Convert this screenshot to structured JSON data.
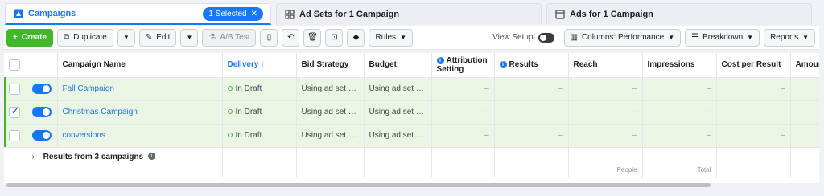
{
  "tabs": [
    {
      "label": "Campaigns",
      "icon": "campaign-flag-icon",
      "selected_badge": "1 Selected"
    },
    {
      "label": "Ad Sets for 1 Campaign",
      "icon": "grid-icon"
    },
    {
      "label": "Ads for 1 Campaign",
      "icon": "ad-page-icon"
    }
  ],
  "toolbar": {
    "create": "Create",
    "duplicate": "Duplicate",
    "edit": "Edit",
    "ab_test": "A/B Test",
    "rules": "Rules",
    "view_setup": "View Setup",
    "columns": "Columns: Performance",
    "breakdown": "Breakdown",
    "reports": "Reports"
  },
  "columns": {
    "name": "Campaign Name",
    "delivery": "Delivery ↑",
    "bid": "Bid Strategy",
    "budget": "Budget",
    "attribution": "Attribution Setting",
    "results": "Results",
    "reach": "Reach",
    "impressions": "Impressions",
    "cost": "Cost per Result",
    "amount": "Amoun"
  },
  "rows": [
    {
      "name": "Fall Campaign",
      "checked": false,
      "delivery": "In Draft",
      "bid": "Using ad set bid...",
      "budget": "Using ad set bu...",
      "dash": "–"
    },
    {
      "name": "Christmas Campaign",
      "checked": true,
      "delivery": "In Draft",
      "bid": "Using ad set bid...",
      "budget": "Using ad set bu...",
      "dash": "–"
    },
    {
      "name": "conversions",
      "checked": false,
      "delivery": "In Draft",
      "bid": "Using ad set bid...",
      "budget": "Using ad set bu...",
      "dash": "–"
    }
  ],
  "summary": {
    "label": "Results from 3 campaigns",
    "dash": "–",
    "reach_sub": "People",
    "impressions_sub": "Total"
  },
  "colors": {
    "accent": "#1877f2",
    "create": "#42b72a",
    "row_bg": "#eaf5e4"
  }
}
